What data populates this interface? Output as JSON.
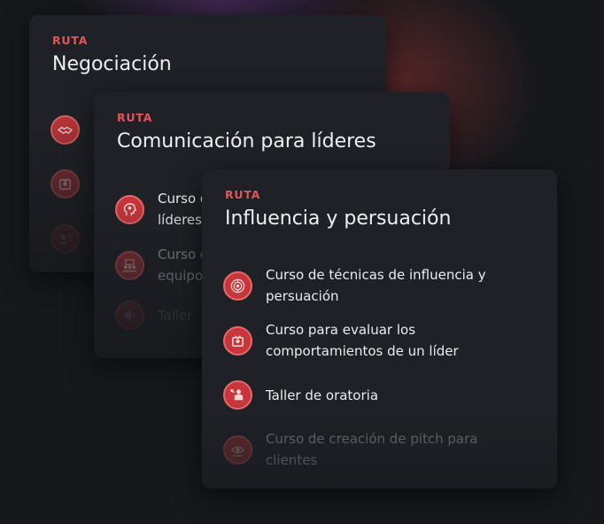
{
  "cards": [
    {
      "label": "RUTA",
      "title": "Negociación",
      "items": [
        {
          "icon": "handshake-icon",
          "text": ""
        },
        {
          "icon": "profile-badge-icon",
          "text": ""
        },
        {
          "icon": "speaker-icon",
          "text": ""
        }
      ]
    },
    {
      "label": "RUTA",
      "title": "Comunicación para líderes",
      "items": [
        {
          "icon": "head-gear-icon",
          "text": "Curso de comunicación para\nlíderes"
        },
        {
          "icon": "team-icon",
          "text": "Curso de gestión de\nequipos"
        },
        {
          "icon": "megaphone-icon",
          "text": "Taller"
        }
      ]
    },
    {
      "label": "RUTA",
      "title": "Influencia y persuación",
      "items": [
        {
          "icon": "influence-icon",
          "text": "Curso de técnicas de influencia y persuación"
        },
        {
          "icon": "profile-badge-icon",
          "text": "Curso para evaluar los comportamientos de un líder"
        },
        {
          "icon": "speaker-podium-icon",
          "text": "Taller de oratoria"
        },
        {
          "icon": "pitch-eye-icon",
          "text": "Curso de creación de pitch para clientes"
        }
      ]
    }
  ],
  "colors": {
    "accent": "#e0575a",
    "icon_bg": "#c8363b",
    "card_bg": "#202126",
    "page_bg": "#17181c"
  }
}
